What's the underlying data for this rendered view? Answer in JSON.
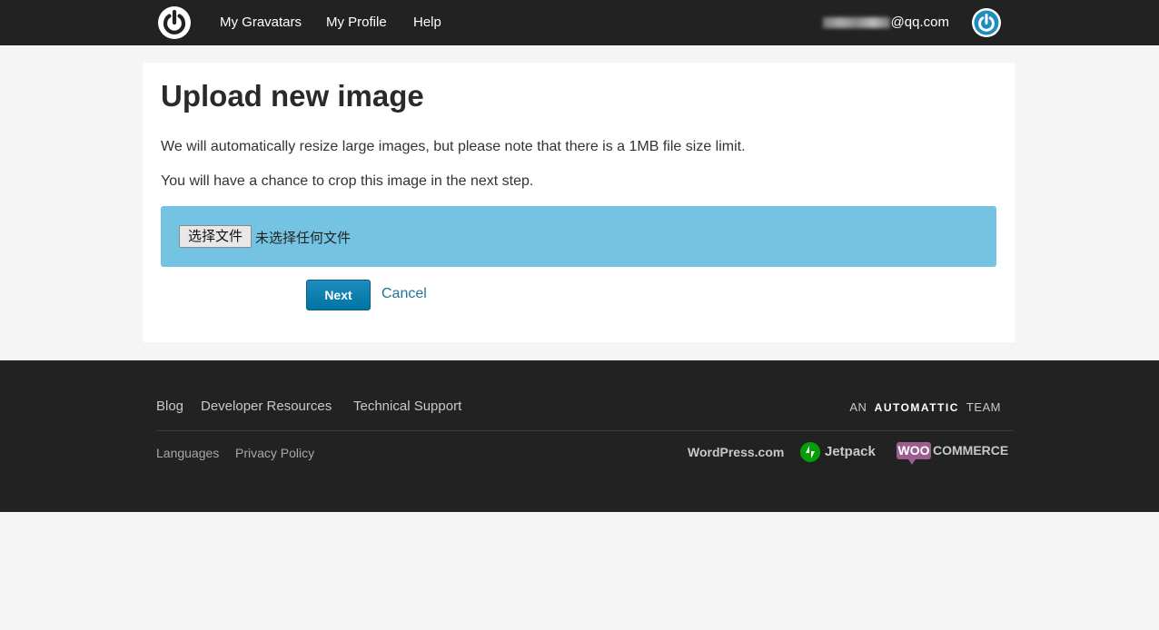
{
  "nav": {
    "links": [
      "My Gravatars",
      "My Profile",
      "Help"
    ],
    "email_suffix": "@qq.com"
  },
  "main": {
    "title": "Upload new image",
    "para1": "We will automatically resize large images, but please note that there is a 1MB file size limit.",
    "para2": "You will have a chance to crop this image in the next step.",
    "file_button": "选择文件",
    "file_status": "未选择任何文件",
    "next_label": "Next",
    "cancel_label": "Cancel"
  },
  "footer": {
    "links_primary": [
      "Blog",
      "Developer Resources",
      "Technical Support"
    ],
    "links_secondary": [
      "Languages",
      "Privacy Policy"
    ],
    "automattic_prefix": "AN",
    "automattic_brand": "AUTOMATTIC",
    "automattic_suffix": "TEAM",
    "wpcom": "WordPress.com",
    "jetpack": "Jetpack",
    "woo_badge": "WOO",
    "woo_text": "COMMERCE"
  },
  "colors": {
    "topbar": "#222222",
    "upload_box": "#74c3e2",
    "primary_button": "#0074a2",
    "link": "#21759b"
  }
}
